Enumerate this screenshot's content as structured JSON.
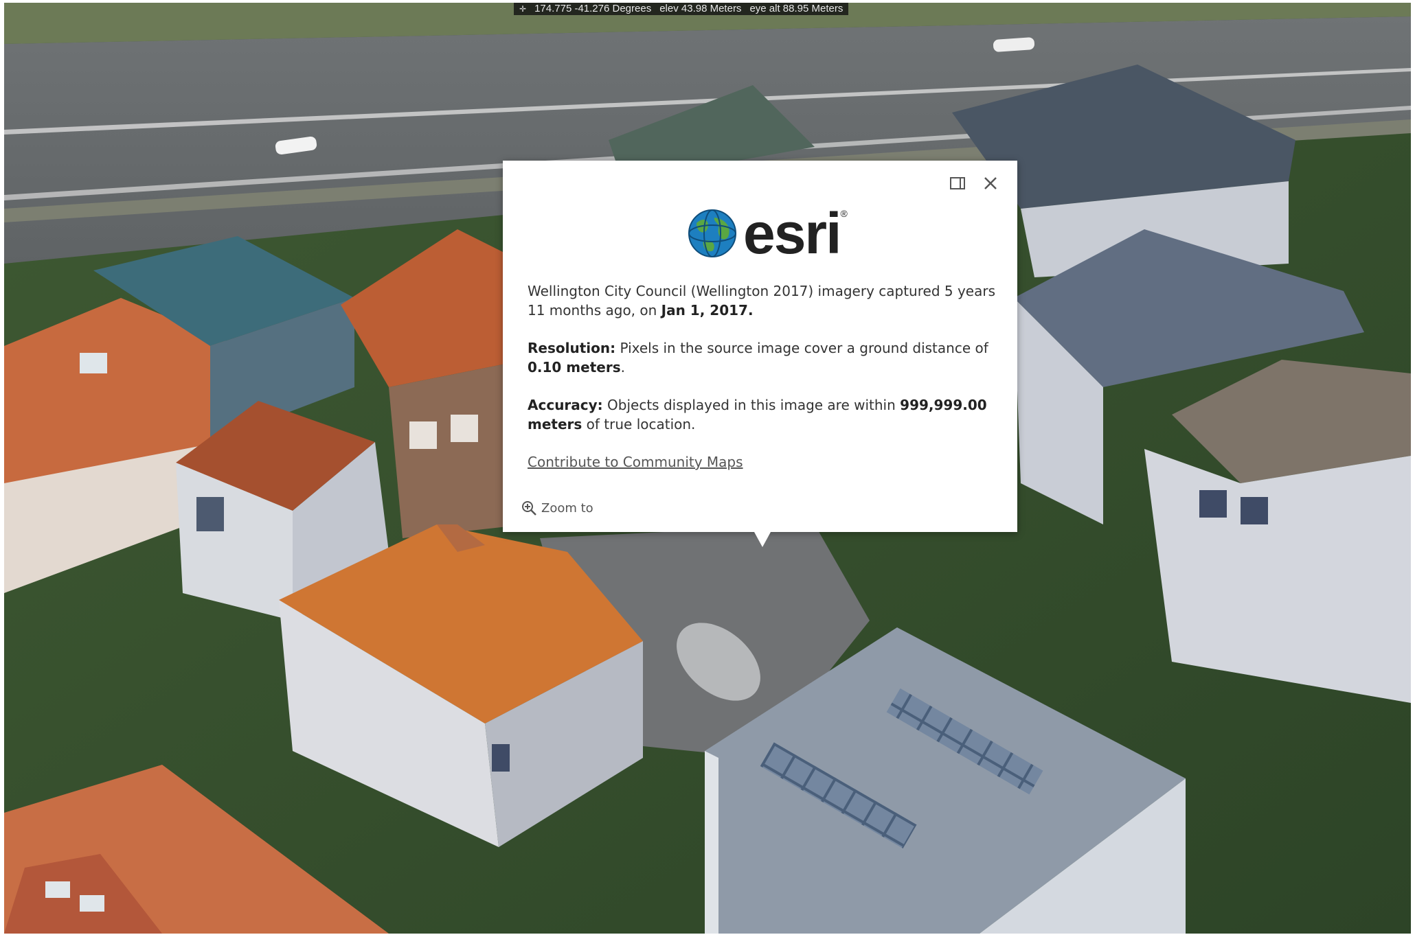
{
  "status_bar": {
    "coordinates": "174.775 -41.276 Degrees",
    "elevation": "elev 43.98 Meters",
    "eye_altitude": "eye alt 88.95 Meters"
  },
  "popup": {
    "logo_text": "esri",
    "logo_mark": "®",
    "imagery": {
      "text": "Wellington City Council (Wellington 2017) imagery captured 5 years 11 months ago, on ",
      "date": "Jan 1, 2017."
    },
    "resolution": {
      "label": "Resolution:",
      "text": " Pixels in the source image cover a ground distance of ",
      "value": "0.10 meters",
      "end": "."
    },
    "accuracy": {
      "label": "Accuracy:",
      "text": " Objects displayed in this image are within ",
      "value": "999,999.00 meters",
      "end": " of true location."
    },
    "contribute_link": "Contribute to Community Maps",
    "zoom_to_label": "Zoom to"
  },
  "icons": {
    "dock": "dock-icon",
    "close": "close-icon",
    "zoom": "zoom-in-icon",
    "globe": "globe-icon",
    "crosshair": "crosshair-icon"
  },
  "colors": {
    "popup_bg": "#ffffff",
    "roof_orange": "#c9652f",
    "roof_grey": "#5d6877",
    "road": "#6b6f72"
  }
}
